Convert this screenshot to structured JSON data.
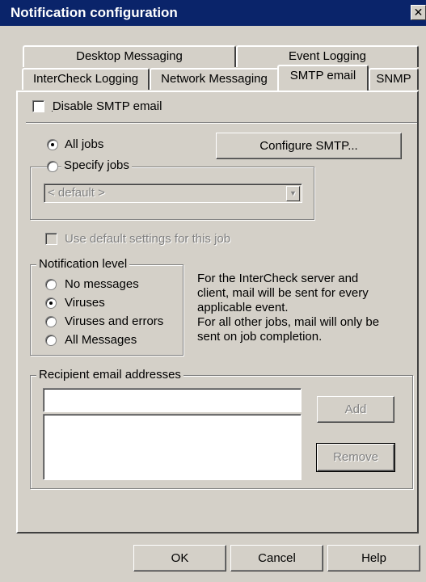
{
  "window": {
    "title": "Notification configuration",
    "close_glyph": "✕"
  },
  "tabs": {
    "row_back": [
      "Desktop Messaging",
      "Event Logging"
    ],
    "row_front": [
      "InterCheck Logging",
      "Network Messaging",
      "SMTP email",
      "SNMP"
    ],
    "active": "SMTP email"
  },
  "smtp": {
    "disable_label": "Disable SMTP email",
    "disable_checked": false,
    "all_jobs_label": "All jobs",
    "specify_jobs_label": "Specify jobs",
    "job_selection": "All jobs",
    "configure_button": "Configure SMTP...",
    "job_combo_value": "< default >",
    "use_default_label": "Use default settings for this job",
    "use_default_checked": false
  },
  "notification_level": {
    "legend": "Notification level",
    "options": [
      "No messages",
      "Viruses",
      "Viruses and errors",
      "All Messages"
    ],
    "selected": "Viruses"
  },
  "info_text": [
    "For the InterCheck server and",
    "client, mail will be sent for every",
    "applicable event.",
    "For all other jobs, mail will only be",
    "sent on job completion."
  ],
  "recipients": {
    "legend": "Recipient email addresses",
    "input_value": "",
    "list_items": [],
    "add_button": "Add",
    "remove_button": "Remove"
  },
  "footer": {
    "ok": "OK",
    "cancel": "Cancel",
    "help": "Help"
  },
  "colors": {
    "face": "#d4d0c8",
    "titlebar": "#0a246a",
    "disabled": "#808080"
  },
  "icons": [
    "close-icon",
    "dropdown-arrow-icon",
    "radio-dot-icon"
  ]
}
